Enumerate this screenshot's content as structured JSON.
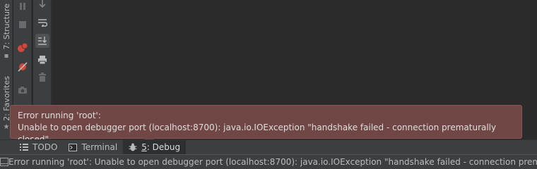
{
  "side_tabs": {
    "structure": "7: Structure",
    "favorites": "2: Favorites"
  },
  "bottom_tabs": [
    {
      "label": "TODO",
      "icon": "todo-list-icon"
    },
    {
      "label": "Terminal",
      "icon": "terminal-icon"
    },
    {
      "label": "5: Debug",
      "icon": "bug-icon",
      "selected": true
    }
  ],
  "debug_tab": {
    "mnemonic": "5",
    "label_rest": ": Debug"
  },
  "balloon": {
    "title": "Error running 'root':",
    "message": "Unable to open debugger port (localhost:8700): java.io.IOException \"handshake failed - connection prematurally closed\""
  },
  "status_bar": {
    "text": "Error running 'root': Unable to open debugger port (localhost:8700): java.io.IOException \"handshake failed - connection prematu"
  },
  "colors": {
    "background": "#2b2b2b",
    "panel": "#3c3f41",
    "balloon_error": "#704745",
    "breakpoint_red": "#d3463c"
  }
}
